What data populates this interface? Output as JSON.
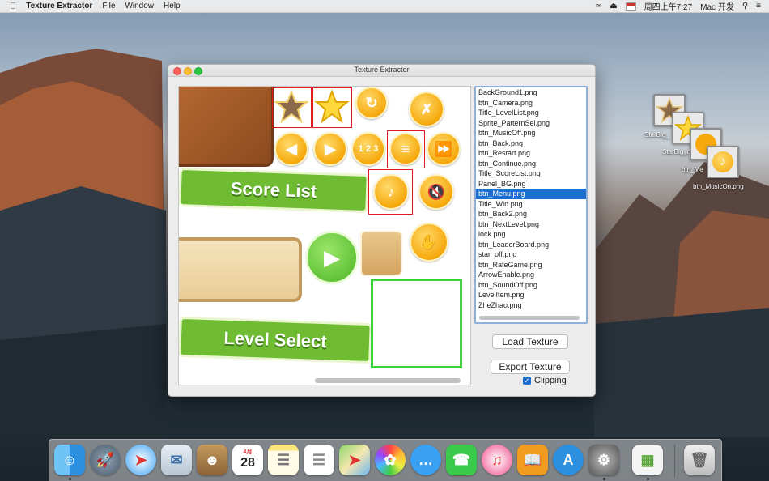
{
  "menubar": {
    "app_name": "Texture Extractor",
    "menus": [
      "File",
      "Window",
      "Help"
    ],
    "clock": "周四上午7:27",
    "user": "Mac 开发"
  },
  "window": {
    "title": "Texture Extractor",
    "file_list": [
      "BackGround1.png",
      "btn_Camera.png",
      "Title_LevelList.png",
      "Sprite_PatternSel.png",
      "btn_MusicOff.png",
      "btn_Back.png",
      "btn_Restart.png",
      "btn_Continue.png",
      "Title_ScoreList.png",
      "Panel_BG.png",
      "btn_Menu.png",
      "Title_Win.png",
      "btn_Back2.png",
      "btn_NextLevel.png",
      "lock.png",
      "btn_LeaderBoard.png",
      "star_off.png",
      "btn_RateGame.png",
      "ArrowEnable.png",
      "btn_SoundOff.png",
      "LevelItem.png",
      "ZheZhao.png"
    ],
    "selected_file": "btn_Menu.png",
    "load_button": "Load Texture",
    "export_button": "Export Texture",
    "clipping_label": "Clipping",
    "clipping_checked": true,
    "sprite_text": {
      "score_list": "Score  List",
      "level_select": "Level Select"
    }
  },
  "desktop_icons": [
    {
      "label": "StarBig_",
      "icon": "star-dark-icon"
    },
    {
      "label": "StarBig_on.png",
      "icon": "star-icon"
    },
    {
      "label": "btn_Me",
      "icon": "menu-icon"
    },
    {
      "label": "btn_MusicOn.png",
      "icon": "music-icon"
    }
  ],
  "dock": {
    "calendar_month": "4月",
    "calendar_day": "28",
    "apps": [
      "finder",
      "launchpad",
      "safari",
      "mail",
      "contacts",
      "calendar",
      "notes",
      "reminders",
      "maps",
      "photos",
      "messages",
      "facetime",
      "itunes",
      "ibooks",
      "app-store",
      "system-preferences",
      "texture-extractor",
      "trash"
    ]
  },
  "colors": {
    "selection": "#1c6ed1",
    "sprite_outline": "#e01b1b",
    "clip_rect": "#3ed13e"
  }
}
